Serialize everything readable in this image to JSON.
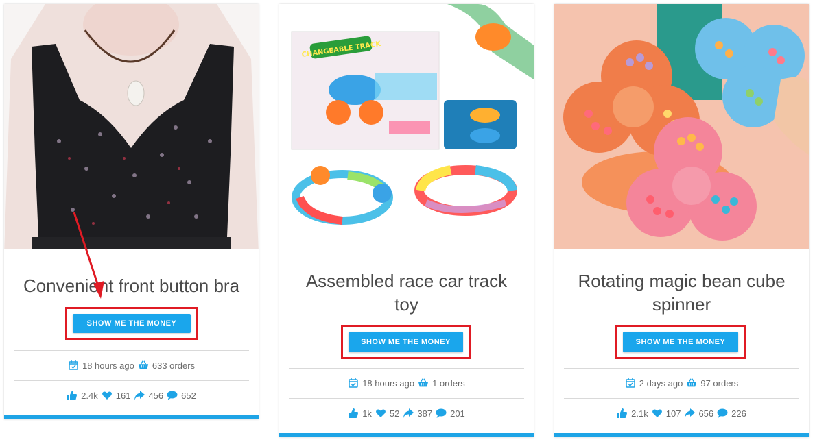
{
  "cards": [
    {
      "title": "Convenient front button bra",
      "button": "SHOW ME THE MONEY",
      "time": "18 hours ago",
      "orders": "633 orders",
      "likes": "2.4k",
      "hearts": "161",
      "shares": "456",
      "comments": "652"
    },
    {
      "title": "Assembled race car track toy",
      "button": "SHOW ME THE MONEY",
      "time": "18 hours ago",
      "orders": "1 orders",
      "likes": "1k",
      "hearts": "52",
      "shares": "387",
      "comments": "201",
      "box_text": "CHANGEABLE TRACK"
    },
    {
      "title": "Rotating magic bean cube spinner",
      "button": "SHOW ME THE MONEY",
      "time": "2 days ago",
      "orders": "97 orders",
      "likes": "2.1k",
      "hearts": "107",
      "shares": "656",
      "comments": "226"
    }
  ],
  "colors": {
    "accent": "#1ea4e6",
    "button": "#1aa6ec",
    "highlight_box": "#e01b24",
    "arrow": "#e01b24"
  }
}
